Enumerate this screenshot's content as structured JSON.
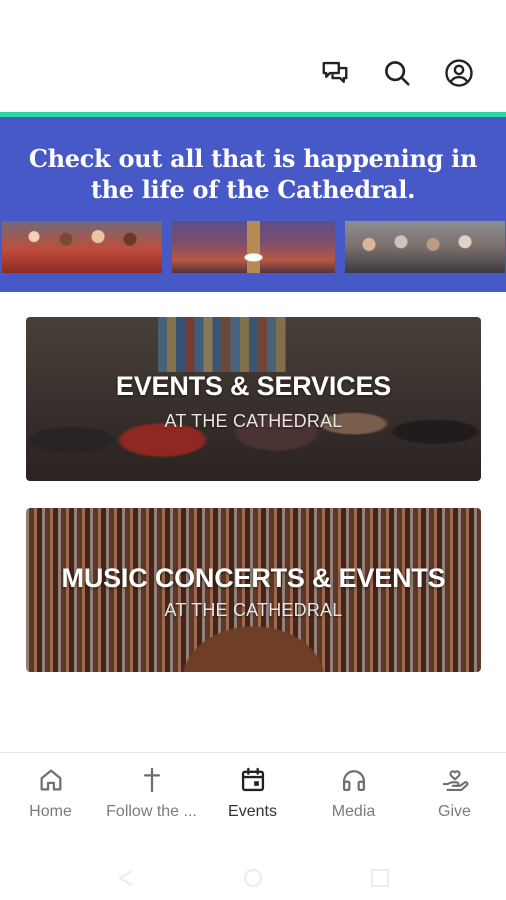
{
  "topbar": {
    "icons": [
      "chat-icon",
      "search-icon",
      "account-icon"
    ]
  },
  "hero": {
    "line1": "Check out all that is happening in",
    "line2": "the life of the Cathedral.",
    "accent_color": "#2fd6a2",
    "background_color": "#4659c6"
  },
  "cards": [
    {
      "title": "EVENTS & SERVICES",
      "subtitle": "AT THE CATHEDRAL"
    },
    {
      "title": "MUSIC CONCERTS & EVENTS",
      "subtitle": "AT THE CATHEDRAL"
    }
  ],
  "bottom_nav": {
    "active": "Events",
    "items": [
      {
        "label": "Home",
        "icon": "home-icon"
      },
      {
        "label": "Follow the ...",
        "icon": "cross-icon"
      },
      {
        "label": "Events",
        "icon": "calendar-icon"
      },
      {
        "label": "Media",
        "icon": "headphones-icon"
      },
      {
        "label": "Give",
        "icon": "give-icon"
      }
    ]
  }
}
